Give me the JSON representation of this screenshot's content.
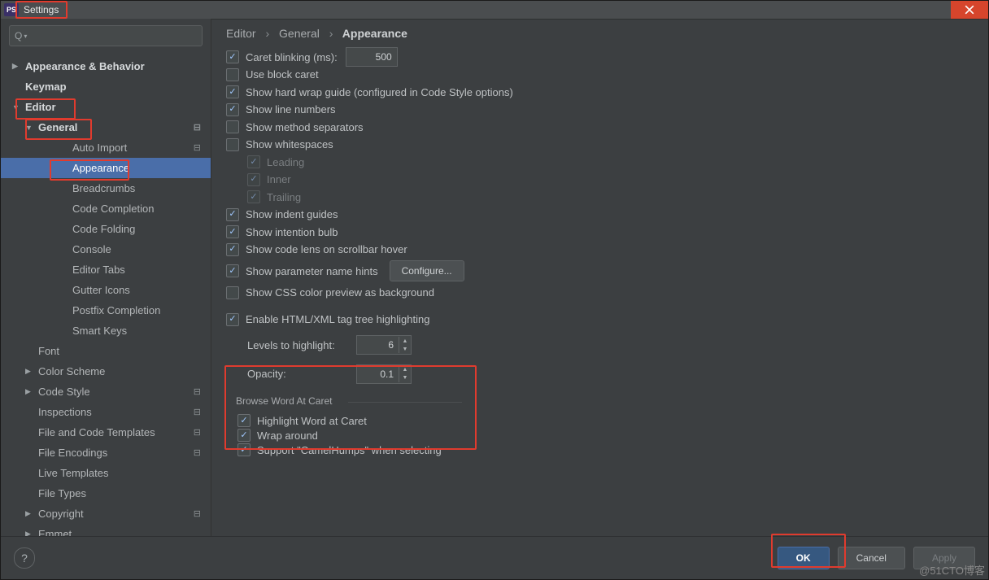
{
  "window": {
    "appIcon": "PS",
    "title": "Settings"
  },
  "sidebar": {
    "items": [
      {
        "label": "Appearance & Behavior",
        "bold": true,
        "arrow": "right",
        "level": 0
      },
      {
        "label": "Keymap",
        "bold": true,
        "level": 0
      },
      {
        "label": "Editor",
        "bold": true,
        "arrow": "down",
        "level": 0
      },
      {
        "label": "General",
        "bold": true,
        "arrow": "down",
        "level": 1,
        "gear": true
      },
      {
        "label": "Auto Import",
        "level": 2,
        "gear": true
      },
      {
        "label": "Appearance",
        "level": 2,
        "selected": true
      },
      {
        "label": "Breadcrumbs",
        "level": 2
      },
      {
        "label": "Code Completion",
        "level": 2
      },
      {
        "label": "Code Folding",
        "level": 2
      },
      {
        "label": "Console",
        "level": 2
      },
      {
        "label": "Editor Tabs",
        "level": 2
      },
      {
        "label": "Gutter Icons",
        "level": 2
      },
      {
        "label": "Postfix Completion",
        "level": 2
      },
      {
        "label": "Smart Keys",
        "level": 2
      },
      {
        "label": "Font",
        "level": 1
      },
      {
        "label": "Color Scheme",
        "arrow": "right",
        "level": 1
      },
      {
        "label": "Code Style",
        "arrow": "right",
        "level": 1,
        "gear": true
      },
      {
        "label": "Inspections",
        "level": 1,
        "gear": true
      },
      {
        "label": "File and Code Templates",
        "level": 1,
        "gear": true
      },
      {
        "label": "File Encodings",
        "level": 1,
        "gear": true
      },
      {
        "label": "Live Templates",
        "level": 1
      },
      {
        "label": "File Types",
        "level": 1
      },
      {
        "label": "Copyright",
        "arrow": "right",
        "level": 1,
        "gear": true
      },
      {
        "label": "Emmet",
        "arrow": "right",
        "level": 1
      }
    ]
  },
  "breadcrumb": {
    "a": "Editor",
    "b": "General",
    "c": "Appearance"
  },
  "options": {
    "caretBlinking": {
      "label": "Caret blinking (ms):",
      "value": "500",
      "checked": true
    },
    "blockCaret": {
      "label": "Use block caret",
      "checked": false
    },
    "hardWrap": {
      "label": "Show hard wrap guide (configured in Code Style options)",
      "checked": true
    },
    "lineNumbers": {
      "label": "Show line numbers",
      "checked": true
    },
    "methodSep": {
      "label": "Show method separators",
      "checked": false
    },
    "whitespaces": {
      "label": "Show whitespaces",
      "checked": false
    },
    "wsLeading": {
      "label": "Leading",
      "checked": true
    },
    "wsInner": {
      "label": "Inner",
      "checked": true
    },
    "wsTrailing": {
      "label": "Trailing",
      "checked": true
    },
    "indentGuides": {
      "label": "Show indent guides",
      "checked": true
    },
    "intentionBulb": {
      "label": "Show intention bulb",
      "checked": true
    },
    "codeLens": {
      "label": "Show code lens on scrollbar hover",
      "checked": true
    },
    "paramHints": {
      "label": "Show parameter name hints",
      "checked": true,
      "button": "Configure..."
    },
    "cssPreview": {
      "label": "Show CSS color preview as background",
      "checked": false
    },
    "htmlTag": {
      "label": "Enable HTML/XML tag tree highlighting",
      "checked": true
    },
    "levels": {
      "label": "Levels to highlight:",
      "value": "6"
    },
    "opacity": {
      "label": "Opacity:",
      "value": "0.1"
    },
    "groupTitle": "Browse Word At Caret",
    "highlightWord": {
      "label": "Highlight Word at Caret",
      "checked": true
    },
    "wrapAround": {
      "label": "Wrap around",
      "checked": true
    },
    "camelHumps": {
      "label": "Support \"CamelHumps\" when selecting",
      "checked": true
    }
  },
  "footer": {
    "ok": "OK",
    "cancel": "Cancel",
    "apply": "Apply",
    "help": "?"
  },
  "watermark": "@51CTO博客"
}
